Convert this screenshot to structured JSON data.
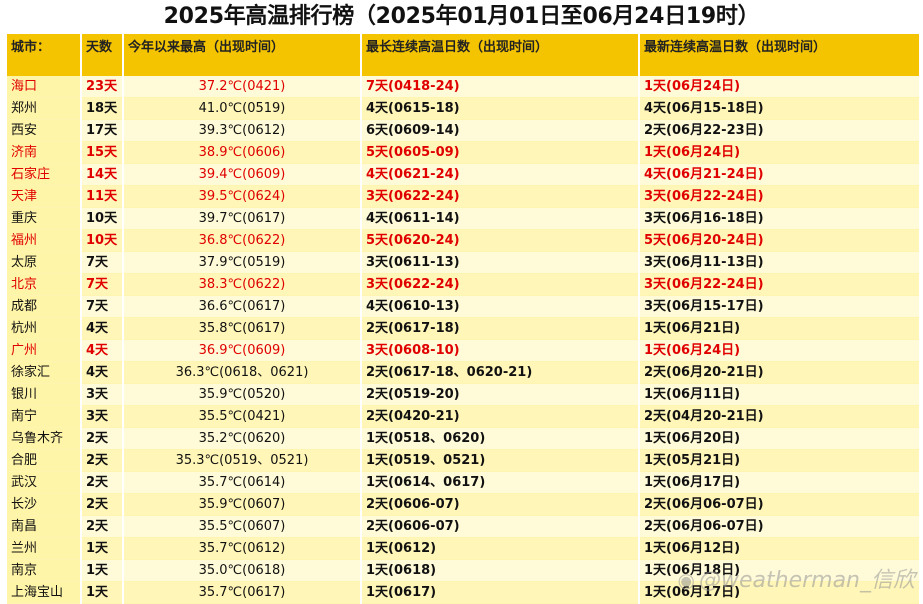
{
  "title": "2025年高温排行榜（2025年01月01日至06月24日19时）",
  "headers": [
    "城市：",
    "天数",
    "今年以来最高（出现时间）",
    "最长连续高温日数（出现时间）",
    "最新连续高温日数（出现时间）"
  ],
  "highlight_color": "#e00000",
  "rows": [
    {
      "city": "海口",
      "days": "23天",
      "max": "37.2℃(0421)",
      "longest": "7天(0418-24)",
      "latest": "1天(06月24日)",
      "hot": true
    },
    {
      "city": "郑州",
      "days": "18天",
      "max": "41.0℃(0519)",
      "longest": "4天(0615-18)",
      "latest": "4天(06月15-18日)",
      "hot": false
    },
    {
      "city": "西安",
      "days": "17天",
      "max": "39.3℃(0612)",
      "longest": "6天(0609-14)",
      "latest": "2天(06月22-23日)",
      "hot": false
    },
    {
      "city": "济南",
      "days": "15天",
      "max": "38.9℃(0606)",
      "longest": "5天(0605-09)",
      "latest": "1天(06月24日)",
      "hot": true
    },
    {
      "city": "石家庄",
      "days": "14天",
      "max": "39.4℃(0609)",
      "longest": "4天(0621-24)",
      "latest": "4天(06月21-24日)",
      "hot": true
    },
    {
      "city": "天津",
      "days": "11天",
      "max": "39.5℃(0624)",
      "longest": "3天(0622-24)",
      "latest": "3天(06月22-24日)",
      "hot": true
    },
    {
      "city": "重庆",
      "days": "10天",
      "max": "39.7℃(0617)",
      "longest": "4天(0611-14)",
      "latest": "3天(06月16-18日)",
      "hot": false
    },
    {
      "city": "福州",
      "days": "10天",
      "max": "36.8℃(0622)",
      "longest": "5天(0620-24)",
      "latest": "5天(06月20-24日)",
      "hot": true
    },
    {
      "city": "太原",
      "days": "7天",
      "max": "37.9℃(0519)",
      "longest": "3天(0611-13)",
      "latest": "3天(06月11-13日)",
      "hot": false
    },
    {
      "city": "北京",
      "days": "7天",
      "max": "38.3℃(0622)",
      "longest": "3天(0622-24)",
      "latest": "3天(06月22-24日)",
      "hot": true
    },
    {
      "city": "成都",
      "days": "7天",
      "max": "36.6℃(0617)",
      "longest": "4天(0610-13)",
      "latest": "3天(06月15-17日)",
      "hot": false
    },
    {
      "city": "杭州",
      "days": "4天",
      "max": "35.8℃(0617)",
      "longest": "2天(0617-18)",
      "latest": "1天(06月21日)",
      "hot": false
    },
    {
      "city": "广州",
      "days": "4天",
      "max": "36.9℃(0609)",
      "longest": "3天(0608-10)",
      "latest": "1天(06月24日)",
      "hot": true
    },
    {
      "city": "徐家汇",
      "days": "4天",
      "max": "36.3℃(0618、0621)",
      "longest": "2天(0617-18、0620-21)",
      "latest": "2天(06月20-21日)",
      "hot": false
    },
    {
      "city": "银川",
      "days": "3天",
      "max": "35.9℃(0520)",
      "longest": "2天(0519-20)",
      "latest": "1天(06月11日)",
      "hot": false
    },
    {
      "city": "南宁",
      "days": "3天",
      "max": "35.5℃(0421)",
      "longest": "2天(0420-21)",
      "latest": "2天(04月20-21日)",
      "hot": false
    },
    {
      "city": "乌鲁木齐",
      "days": "2天",
      "max": "35.2℃(0620)",
      "longest": "1天(0518、0620)",
      "latest": "1天(06月20日)",
      "hot": false
    },
    {
      "city": "合肥",
      "days": "2天",
      "max": "35.3℃(0519、0521)",
      "longest": "1天(0519、0521)",
      "latest": "1天(05月21日)",
      "hot": false
    },
    {
      "city": "武汉",
      "days": "2天",
      "max": "35.7℃(0614)",
      "longest": "1天(0614、0617)",
      "latest": "1天(06月17日)",
      "hot": false
    },
    {
      "city": "长沙",
      "days": "2天",
      "max": "35.9℃(0607)",
      "longest": "2天(0606-07)",
      "latest": "2天(06月06-07日)",
      "hot": false
    },
    {
      "city": "南昌",
      "days": "2天",
      "max": "35.5℃(0607)",
      "longest": "2天(0606-07)",
      "latest": "2天(06月06-07日)",
      "hot": false
    },
    {
      "city": "兰州",
      "days": "1天",
      "max": "35.7℃(0612)",
      "longest": "1天(0612)",
      "latest": "1天(06月12日)",
      "hot": false
    },
    {
      "city": "南京",
      "days": "1天",
      "max": "35.0℃(0618)",
      "longest": "1天(0618)",
      "latest": "1天(06月18日)",
      "hot": false
    },
    {
      "city": "上海宝山",
      "days": "1天",
      "max": "35.7℃(0617)",
      "longest": "1天(0617)",
      "latest": "1天(06月17日)",
      "hot": false
    }
  ],
  "watermark": "@weatherman_信欣",
  "watermark_icon": "weibo-logo-icon"
}
